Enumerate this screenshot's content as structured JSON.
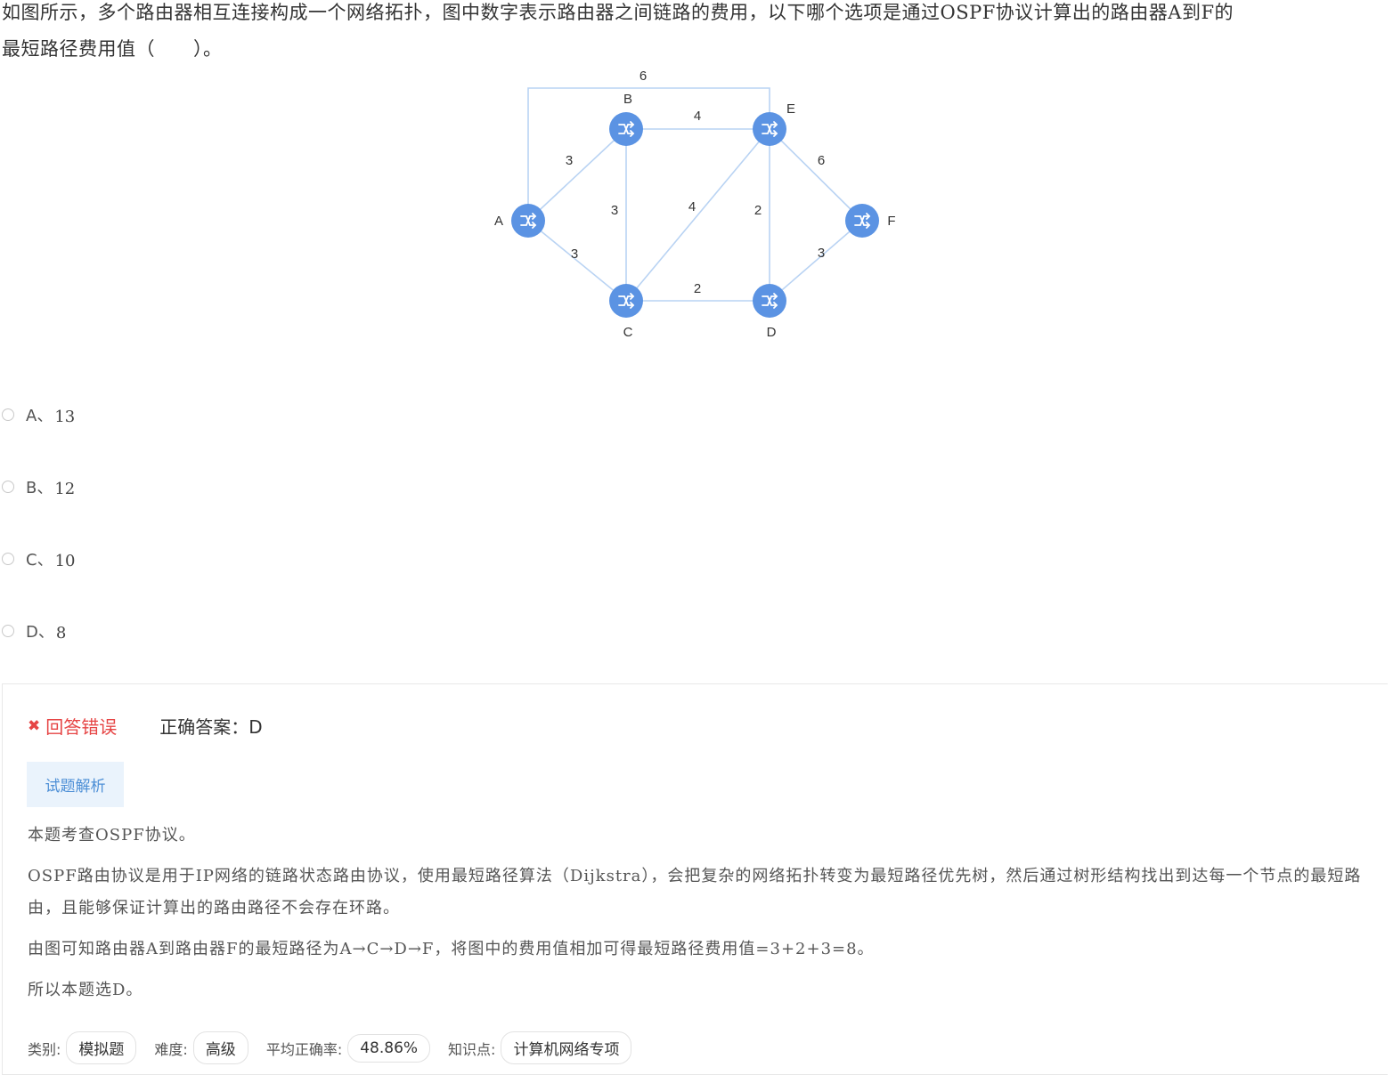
{
  "question": {
    "line1": "如图所示，多个路由器相互连接构成一个网络拓扑，图中数字表示路由器之间链路的费用，以下哪个选项是通过OSPF协议计算出的路由器A到F的",
    "line2": "最短路径费用值（　　）。"
  },
  "diagram": {
    "nodes": {
      "a": "A",
      "b": "B",
      "c": "C",
      "d": "D",
      "e": "E",
      "f": "F"
    },
    "costs": {
      "ae_top": "6",
      "ab": "3",
      "ac": "3",
      "bc": "3",
      "be": "4",
      "ce": "4",
      "cd": "2",
      "ed": "2",
      "ef": "6",
      "df": "3"
    },
    "link_color": "#b9d3f3",
    "router_color": "#5b93e3"
  },
  "options": [
    {
      "letter": "A、",
      "value": "13"
    },
    {
      "letter": "B、",
      "value": "12"
    },
    {
      "letter": "C、",
      "value": "10"
    },
    {
      "letter": "D、",
      "value": "8"
    }
  ],
  "result": {
    "status_icon": "✖",
    "status_text": "回答错误",
    "answer_text": "正确答案：D",
    "tab_label": "试题解析",
    "paragraphs": [
      "本题考查OSPF协议。",
      "OSPF路由协议是用于IP网络的链路状态路由协议，使用最短路径算法（Dijkstra），会把复杂的网络拓扑转变为最短路径优先树，然后通过树形结构找出到达每一个节点的最短路由，且能够保证计算出的路由路径不会存在环路。",
      "由图可知路由器A到路由器F的最短路径为A→C→D→F，将图中的费用值相加可得最短路径费用值=3+2+3=8。",
      "所以本题选D。"
    ],
    "meta": [
      {
        "label": "类别:",
        "value": "模拟题"
      },
      {
        "label": "难度:",
        "value": "高级"
      },
      {
        "label": "平均正确率:",
        "value": "48.86%"
      },
      {
        "label": "知识点:",
        "value": "计算机网络专项"
      }
    ],
    "error_color": "#e64545",
    "tab_color": "#4d8fd6"
  }
}
